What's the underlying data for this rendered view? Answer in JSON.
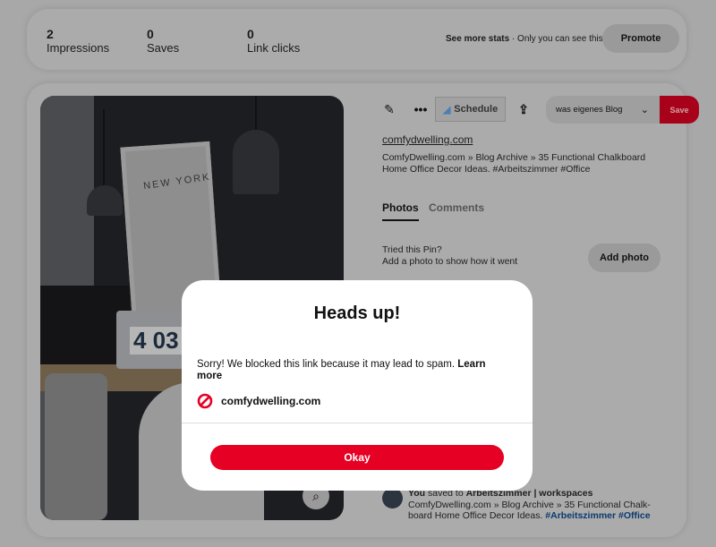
{
  "stats": [
    {
      "value": "2",
      "label": "Impressions"
    },
    {
      "value": "0",
      "label": "Saves"
    },
    {
      "value": "0",
      "label": "Link clicks"
    }
  ],
  "see_more": "See more stats",
  "only_you": " · Only you can see this",
  "promote": "Promote",
  "toolbar": {
    "edit_icon": "pencil-icon",
    "more_icon": "ellipsis-icon",
    "schedule": "Schedule",
    "share_icon": "upload-icon",
    "board": "was eigenes Blog",
    "save": "Save"
  },
  "pin": {
    "link": "comfydwelling.com",
    "description": "ComfyDwelling.com » Blog Archive » 35 Functional Chalkboard Home Office Decor Ideas. #Arbeitszimmer #Office",
    "image_text": "NEW YORK",
    "clock": "4 03"
  },
  "tabs": [
    {
      "label": "Photos",
      "active": true
    },
    {
      "label": "Comments",
      "active": false
    }
  ],
  "tried": {
    "line1": "Tried this Pin?",
    "line2": "Add a photo to show how it went",
    "button": "Add photo"
  },
  "activity": {
    "you": "You",
    "saved_to": " saved to ",
    "board": "Arbeitszimmer | workspaces",
    "text": "ComfyDwelling.com » Blog Archive » 35 Functional Chalk-board Home Office Decor Ideas. ",
    "tags": "#Arbeitszimmer #Office"
  },
  "modal": {
    "title": "Heads up!",
    "message": "Sorry! We blocked this link because it may lead to spam. ",
    "learn_more": "Learn more",
    "domain": "comfydwelling.com",
    "blocked_icon": "prohibited-icon",
    "okay": "Okay"
  },
  "colors": {
    "accent": "#e60023",
    "link": "#0b3a6e"
  }
}
